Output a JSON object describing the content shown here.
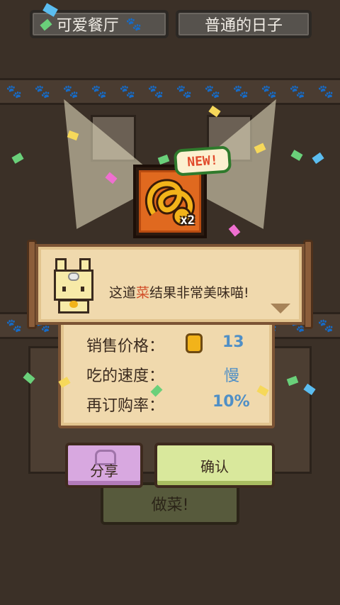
{
  "header": {
    "restaurant_name": "可爱餐厅",
    "day_label": "普通的日子",
    "paw_icon": "paw-icon"
  },
  "dish": {
    "badge": "NEW!",
    "quantity": "x2",
    "icon": "pretzel-dish-icon"
  },
  "dialog": {
    "text_before": "这道",
    "text_highlight": "菜",
    "text_after": "结果非常美味喵!",
    "speaker_icon": "cat-chef-icon",
    "next_icon": "next-arrow-icon"
  },
  "stats": {
    "price_label": "销售价格：",
    "price_value": "13",
    "coin_icon": "coin-icon",
    "speed_label": "吃的速度：",
    "speed_value": "慢",
    "reorder_label": "再订购率：",
    "reorder_value": "10%"
  },
  "buttons": {
    "share_label": "分享",
    "confirm_label": "确认"
  },
  "background": {
    "cook_label": "做菜!"
  },
  "colors": {
    "background": "#3b3027",
    "paper": "#f0d9ad",
    "value_blue": "#4f8fc6",
    "highlight": "#d14f2a",
    "share_button": "#d8a8e0",
    "confirm_button": "#d9e89c"
  }
}
